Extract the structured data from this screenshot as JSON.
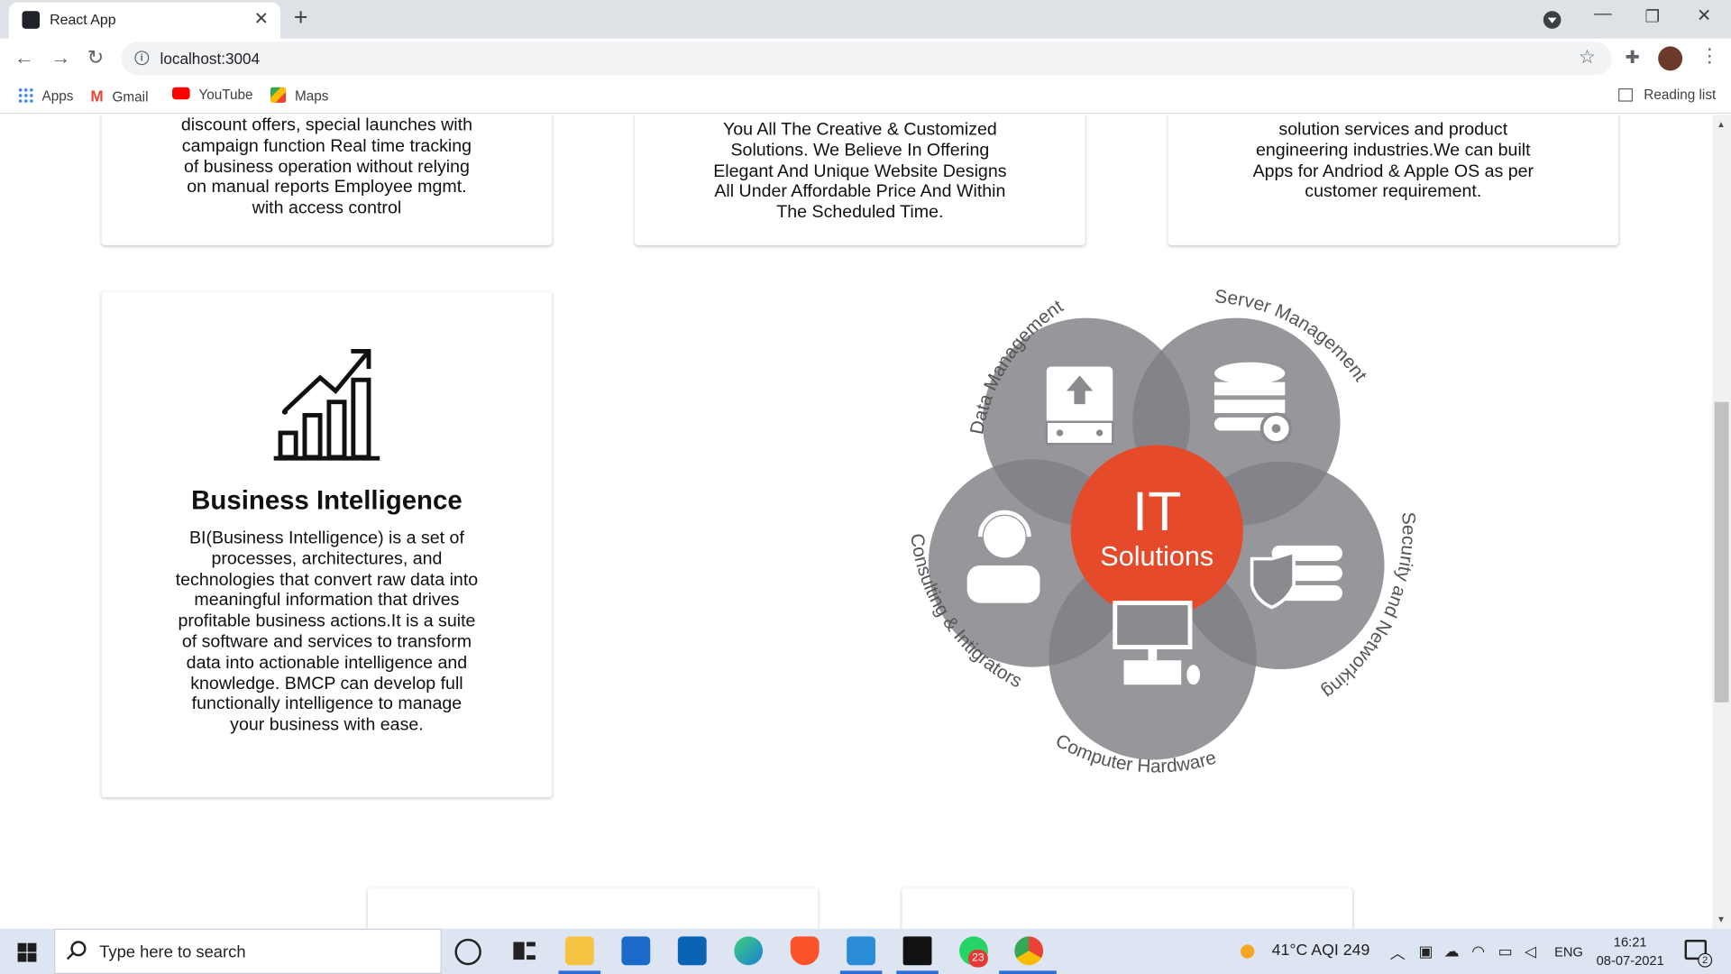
{
  "browser": {
    "tab_title": "React App",
    "url": "localhost:3004",
    "bookmarks": [
      "Apps",
      "Gmail",
      "YouTube",
      "Maps"
    ],
    "reading_list": "Reading list"
  },
  "cards_top": [
    {
      "text": "discount offers, special launches with campaign function Real time tracking of business operation without relying on manual reports Employee mgmt. with access control"
    },
    {
      "text": "You All The Creative & Customized Solutions. We Believe In Offering Elegant And Unique Website Designs All Under Affordable Price And Within The Scheduled Time."
    },
    {
      "text": "solution services and product engineering industries.We can built Apps for Andriod & Apple OS as per customer requirement."
    }
  ],
  "bi_card": {
    "icon": "growth-chart-icon",
    "title": "Business Intelligence",
    "text": "BI(Business Intelligence) is a set of processes, architectures, and technologies that convert raw data into meaningful information that drives profitable business actions.It is a suite of software and services to transform data into actionable intelligence and knowledge. BMCP can develop full functionally intelligence to manage your business with ease."
  },
  "it_diagram": {
    "center_line1": "IT",
    "center_line2": "Solutions",
    "segments": [
      "Data Management",
      "Server Management",
      "Security and Networking",
      "Computer Hardware",
      "Consulting & Intigrators"
    ],
    "center_color": "#e8512e",
    "petal_color": "#8a8a8f"
  },
  "taskbar": {
    "search_placeholder": "Type here to search",
    "weather": "41°C  AQI 249",
    "language": "ENG",
    "time": "16:21",
    "date": "08-07-2021",
    "whatsapp_badge": "23",
    "notification_count": "2"
  }
}
